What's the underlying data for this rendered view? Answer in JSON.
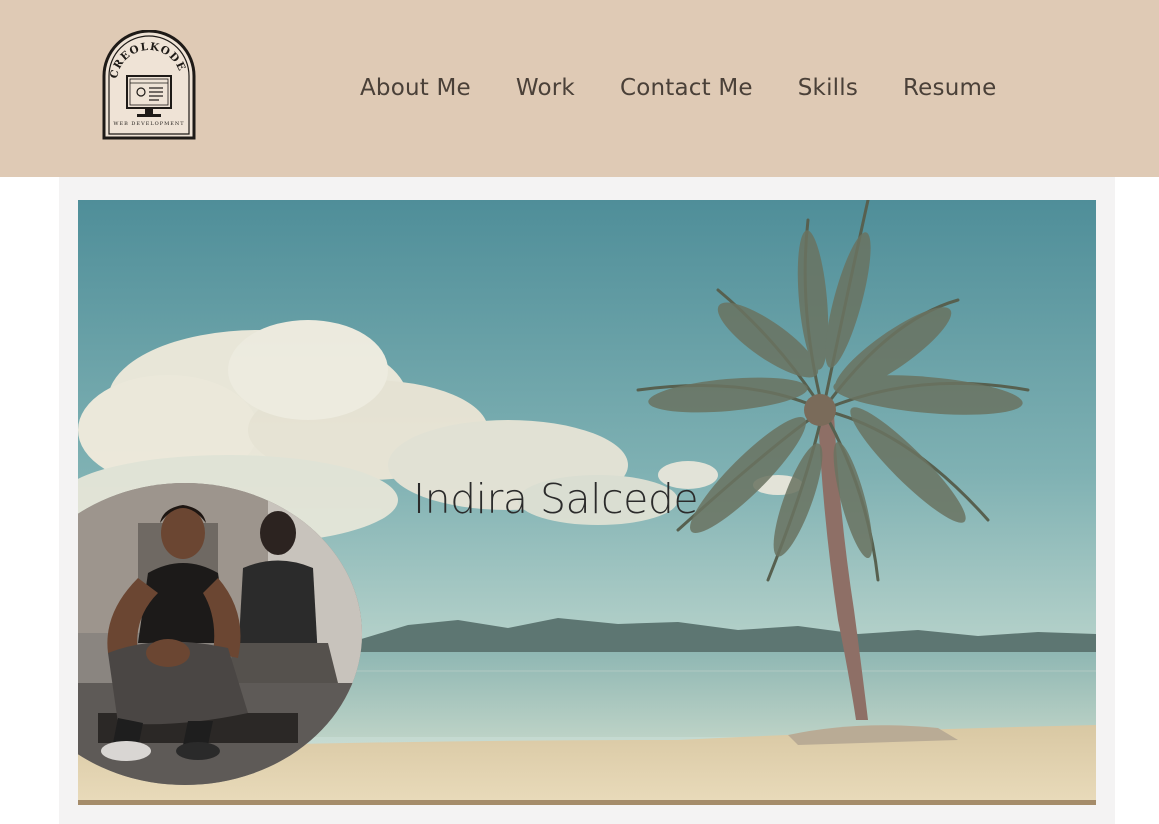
{
  "header": {
    "logo": {
      "brand": "CREOLKODE",
      "tagline": "WEB DEVELOPMENT"
    },
    "nav": [
      {
        "label": "About Me"
      },
      {
        "label": "Work"
      },
      {
        "label": "Contact Me"
      },
      {
        "label": "Skills"
      },
      {
        "label": "Resume"
      }
    ]
  },
  "hero": {
    "name": "Indira Salcede",
    "background": "beach-with-palm-tree",
    "avatar": "profile-photo"
  },
  "colors": {
    "header_bg": "#dfcab5",
    "nav_text": "#4a4038",
    "page_bg": "#f4f3f3"
  }
}
